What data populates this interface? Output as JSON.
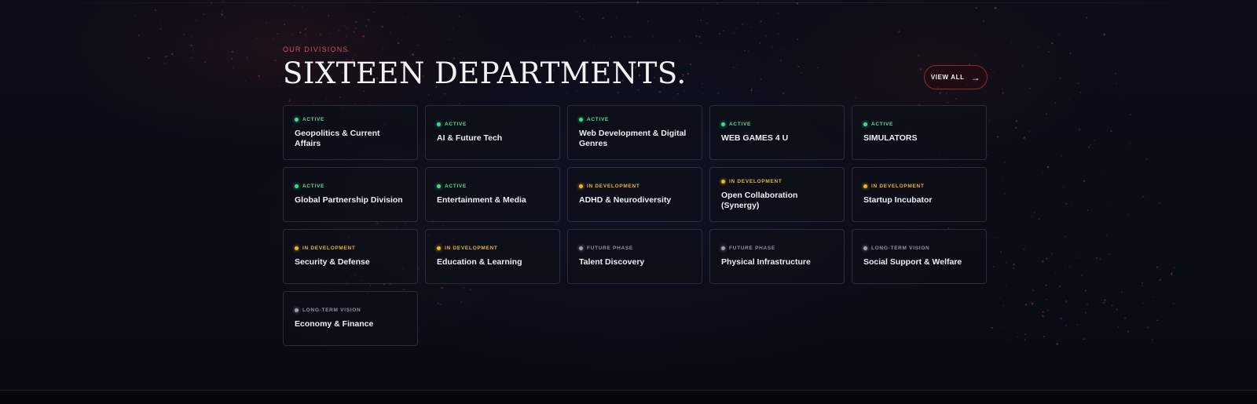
{
  "section": {
    "eyebrow": "OUR DIVISIONS",
    "heading": "SIXTEEN DEPARTMENTS.",
    "view_all_label": "VIEW ALL",
    "view_all_icon": "arrow-right-icon"
  },
  "status_colors": {
    "ACTIVE": "#3ddc84",
    "IN DEVELOPMENT": "#f0b429",
    "FUTURE PHASE": "#9aa0ad",
    "LONG-TERM VISION": "#9aa0ad"
  },
  "departments": [
    {
      "status": "ACTIVE",
      "title": "Geopolitics & Current Affairs"
    },
    {
      "status": "ACTIVE",
      "title": "AI & Future Tech"
    },
    {
      "status": "ACTIVE",
      "title": "Web Development & Digital Genres"
    },
    {
      "status": "ACTIVE",
      "title": "WEB GAMES 4 U"
    },
    {
      "status": "ACTIVE",
      "title": "SIMULATORS"
    },
    {
      "status": "ACTIVE",
      "title": "Global Partnership Division"
    },
    {
      "status": "ACTIVE",
      "title": "Entertainment & Media"
    },
    {
      "status": "IN DEVELOPMENT",
      "title": "ADHD & Neurodiversity"
    },
    {
      "status": "IN DEVELOPMENT",
      "title": "Open Collaboration (Synergy)"
    },
    {
      "status": "IN DEVELOPMENT",
      "title": "Startup Incubator"
    },
    {
      "status": "IN DEVELOPMENT",
      "title": "Security & Defense"
    },
    {
      "status": "IN DEVELOPMENT",
      "title": "Education & Learning"
    },
    {
      "status": "FUTURE PHASE",
      "title": "Talent Discovery"
    },
    {
      "status": "FUTURE PHASE",
      "title": "Physical Infrastructure"
    },
    {
      "status": "LONG-TERM VISION",
      "title": "Social Support & Welfare"
    },
    {
      "status": "LONG-TERM VISION",
      "title": "Economy & Finance"
    }
  ]
}
